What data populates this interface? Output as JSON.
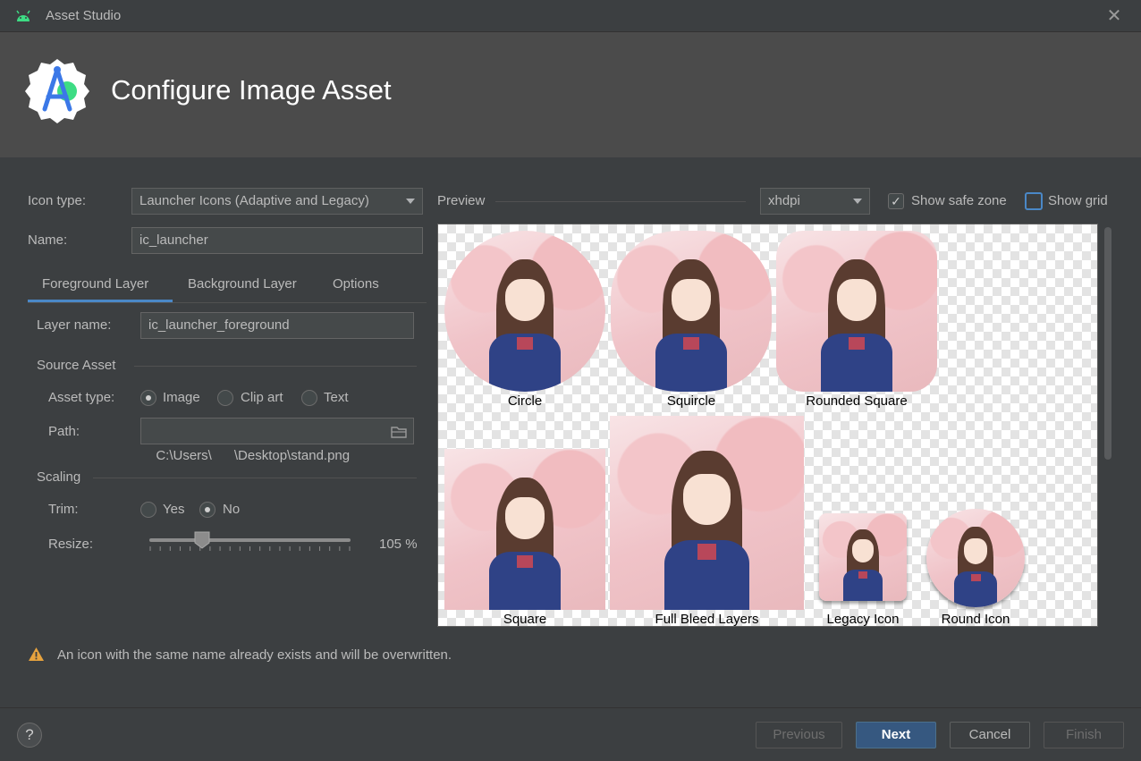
{
  "window": {
    "title": "Asset Studio",
    "close_icon": "close-icon"
  },
  "header": {
    "title": "Configure Image Asset",
    "logo_icon": "android-studio-logo"
  },
  "form": {
    "icon_type_label": "Icon type:",
    "icon_type_value": "Launcher Icons (Adaptive and Legacy)",
    "name_label": "Name:",
    "name_value": "ic_launcher"
  },
  "tabs": [
    {
      "label": "Foreground Layer",
      "active": true
    },
    {
      "label": "Background Layer",
      "active": false
    },
    {
      "label": "Options",
      "active": false
    }
  ],
  "foreground": {
    "layer_name_label": "Layer name:",
    "layer_name_value": "ic_launcher_foreground",
    "source_asset_title": "Source Asset",
    "asset_type_label": "Asset type:",
    "asset_type_options": [
      "Image",
      "Clip art",
      "Text"
    ],
    "asset_type_selected": "Image",
    "path_label": "Path:",
    "path_value": "C:\\Users\\      \\Desktop\\stand.png",
    "scaling_title": "Scaling",
    "trim_label": "Trim:",
    "trim_options": [
      "Yes",
      "No"
    ],
    "trim_selected": "No",
    "resize_label": "Resize:",
    "resize_value": "105 %",
    "resize_fraction": 0.26
  },
  "preview": {
    "label": "Preview",
    "density": "xhdpi",
    "show_safe_zone_label": "Show safe zone",
    "show_safe_zone": true,
    "show_grid_label": "Show grid",
    "show_grid": false,
    "icons": [
      "Circle",
      "Squircle",
      "Rounded Square",
      "Square",
      "Full Bleed Layers",
      "Legacy Icon",
      "Round Icon"
    ]
  },
  "warning": {
    "icon": "warning-icon",
    "text": "An icon with the same name already exists and will be overwritten."
  },
  "footer": {
    "help_label": "?",
    "previous_label": "Previous",
    "next_label": "Next",
    "cancel_label": "Cancel",
    "finish_label": "Finish"
  }
}
